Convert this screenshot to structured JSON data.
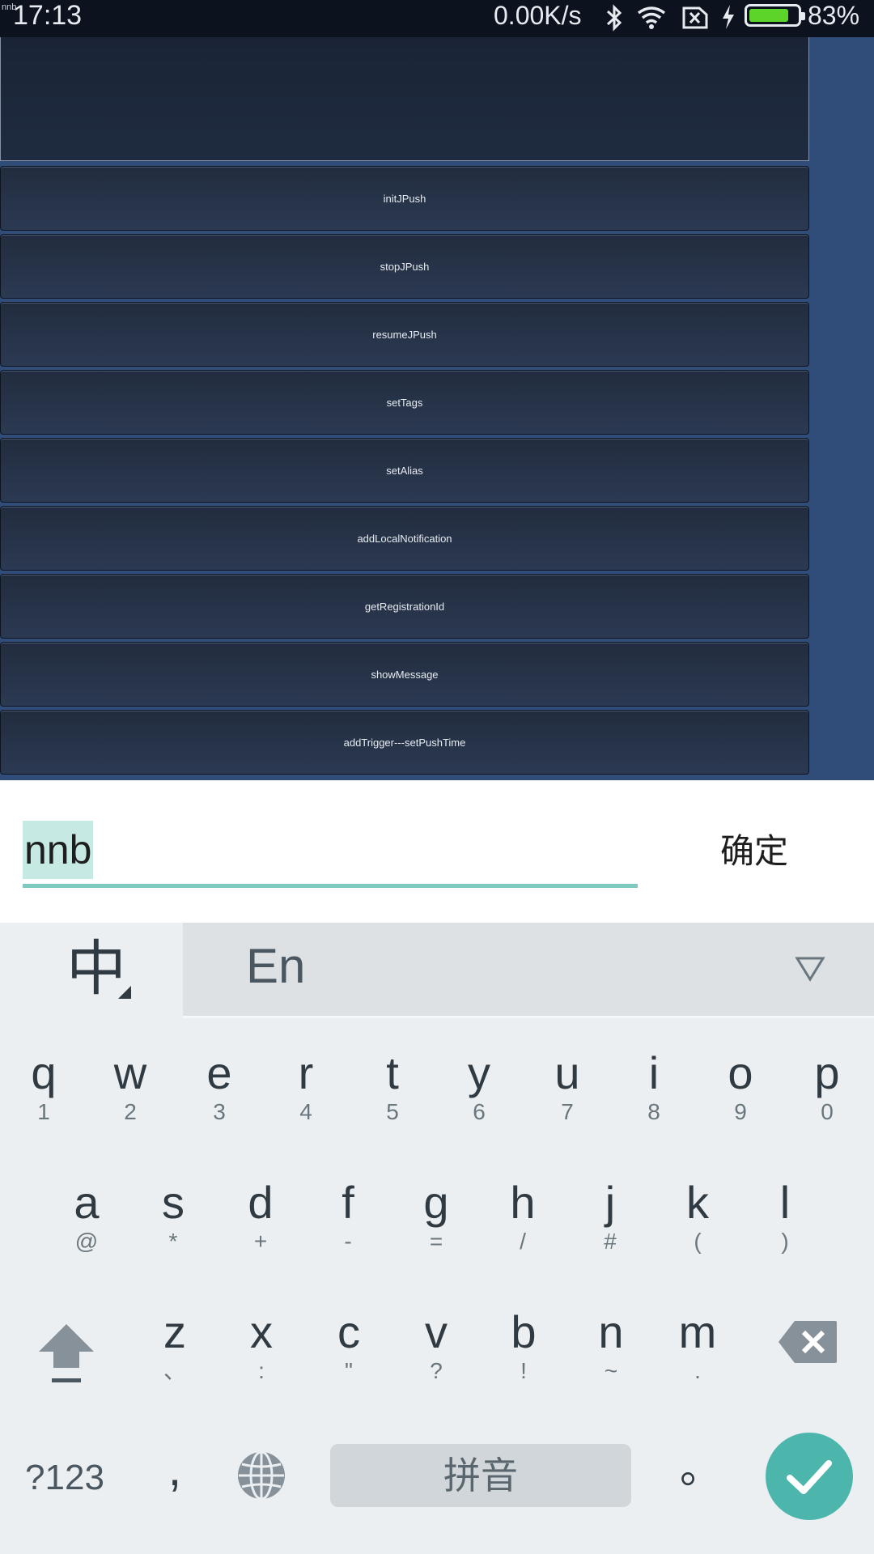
{
  "status_bar": {
    "tiny_label": "nnb",
    "time": "17:13",
    "net_speed": "0.00K/s",
    "battery_percent_text": "83%",
    "battery_level": 0.83,
    "icons": [
      "bluetooth-icon",
      "wifi-icon",
      "no-sim-icon",
      "charging-icon",
      "battery-icon"
    ]
  },
  "app": {
    "buttons": [
      "initJPush",
      "stopJPush",
      "resumeJPush",
      "setTags",
      "setAlias",
      "addLocalNotification",
      "getRegistrationId",
      "showMessage",
      "addTrigger---setPushTime"
    ]
  },
  "input": {
    "value": "nnb",
    "confirm_label": "确定"
  },
  "keyboard": {
    "lang_label": "中",
    "candidate": "En",
    "row1": [
      {
        "main": "q",
        "sub": "1"
      },
      {
        "main": "w",
        "sub": "2"
      },
      {
        "main": "e",
        "sub": "3"
      },
      {
        "main": "r",
        "sub": "4"
      },
      {
        "main": "t",
        "sub": "5"
      },
      {
        "main": "y",
        "sub": "6"
      },
      {
        "main": "u",
        "sub": "7"
      },
      {
        "main": "i",
        "sub": "8"
      },
      {
        "main": "o",
        "sub": "9"
      },
      {
        "main": "p",
        "sub": "0"
      }
    ],
    "row2": [
      {
        "main": "a",
        "sub": "@"
      },
      {
        "main": "s",
        "sub": "*"
      },
      {
        "main": "d",
        "sub": "+"
      },
      {
        "main": "f",
        "sub": "-"
      },
      {
        "main": "g",
        "sub": "="
      },
      {
        "main": "h",
        "sub": "/"
      },
      {
        "main": "j",
        "sub": "#"
      },
      {
        "main": "k",
        "sub": "("
      },
      {
        "main": "l",
        "sub": ")"
      }
    ],
    "row3": [
      {
        "main": "z",
        "sub": "、"
      },
      {
        "main": "x",
        "sub": ":"
      },
      {
        "main": "c",
        "sub": "\""
      },
      {
        "main": "v",
        "sub": "?"
      },
      {
        "main": "b",
        "sub": "!"
      },
      {
        "main": "n",
        "sub": "~"
      },
      {
        "main": "m",
        "sub": "."
      }
    ],
    "symbols_label": "?123",
    "comma_label": ",",
    "space_label": "拼音",
    "period_label": "。"
  },
  "colors": {
    "accent": "#4db6ac",
    "input_underline": "#7ec9c0",
    "selection": "#c6e9e4",
    "battery_fill": "#5cd42a"
  }
}
